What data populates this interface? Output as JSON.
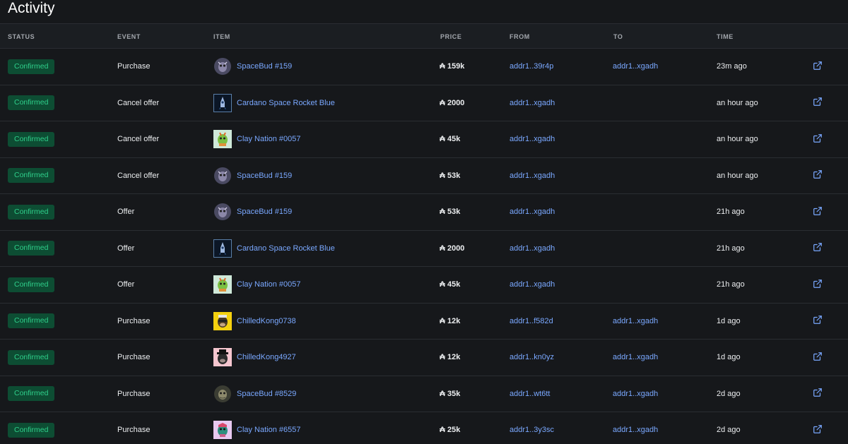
{
  "page": {
    "title": "Activity"
  },
  "columns": {
    "status": "STATUS",
    "event": "EVENT",
    "item": "ITEM",
    "price": "PRICE",
    "from": "FROM",
    "to": "TO",
    "time": "TIME"
  },
  "currency_symbol": "₳",
  "colors": {
    "accent_link": "#7aa8ff",
    "status_bg": "#0d4d33",
    "status_text": "#2fd08b",
    "background": "#16181b"
  },
  "rows": [
    {
      "status": "Confirmed",
      "event": "Purchase",
      "thumb": "spacebud-round",
      "item": "SpaceBud #159",
      "price": "159k",
      "from": "addr1..39r4p",
      "to": "addr1..xgadh",
      "time": "23m ago"
    },
    {
      "status": "Confirmed",
      "event": "Cancel offer",
      "thumb": "rocket-square",
      "item": "Cardano Space Rocket Blue",
      "price": "2000",
      "from": "addr1..xgadh",
      "to": "",
      "time": "an hour ago"
    },
    {
      "status": "Confirmed",
      "event": "Cancel offer",
      "thumb": "clay-square",
      "item": "Clay Nation #0057",
      "price": "45k",
      "from": "addr1..xgadh",
      "to": "",
      "time": "an hour ago"
    },
    {
      "status": "Confirmed",
      "event": "Cancel offer",
      "thumb": "spacebud-round",
      "item": "SpaceBud #159",
      "price": "53k",
      "from": "addr1..xgadh",
      "to": "",
      "time": "an hour ago"
    },
    {
      "status": "Confirmed",
      "event": "Offer",
      "thumb": "spacebud-round",
      "item": "SpaceBud #159",
      "price": "53k",
      "from": "addr1..xgadh",
      "to": "",
      "time": "21h ago"
    },
    {
      "status": "Confirmed",
      "event": "Offer",
      "thumb": "rocket-square",
      "item": "Cardano Space Rocket Blue",
      "price": "2000",
      "from": "addr1..xgadh",
      "to": "",
      "time": "21h ago"
    },
    {
      "status": "Confirmed",
      "event": "Offer",
      "thumb": "clay-square",
      "item": "Clay Nation #0057",
      "price": "45k",
      "from": "addr1..xgadh",
      "to": "",
      "time": "21h ago"
    },
    {
      "status": "Confirmed",
      "event": "Purchase",
      "thumb": "kong-yellow",
      "item": "ChilledKong0738",
      "price": "12k",
      "from": "addr1..f582d",
      "to": "addr1..xgadh",
      "time": "1d ago"
    },
    {
      "status": "Confirmed",
      "event": "Purchase",
      "thumb": "kong-pink",
      "item": "ChilledKong4927",
      "price": "12k",
      "from": "addr1..kn0yz",
      "to": "addr1..xgadh",
      "time": "1d ago"
    },
    {
      "status": "Confirmed",
      "event": "Purchase",
      "thumb": "spacebud-olive",
      "item": "SpaceBud #8529",
      "price": "35k",
      "from": "addr1..wt6tt",
      "to": "addr1..xgadh",
      "time": "2d ago"
    },
    {
      "status": "Confirmed",
      "event": "Purchase",
      "thumb": "clay-pink",
      "item": "Clay Nation #6557",
      "price": "25k",
      "from": "addr1..3y3sc",
      "to": "addr1..xgadh",
      "time": "2d ago"
    }
  ]
}
